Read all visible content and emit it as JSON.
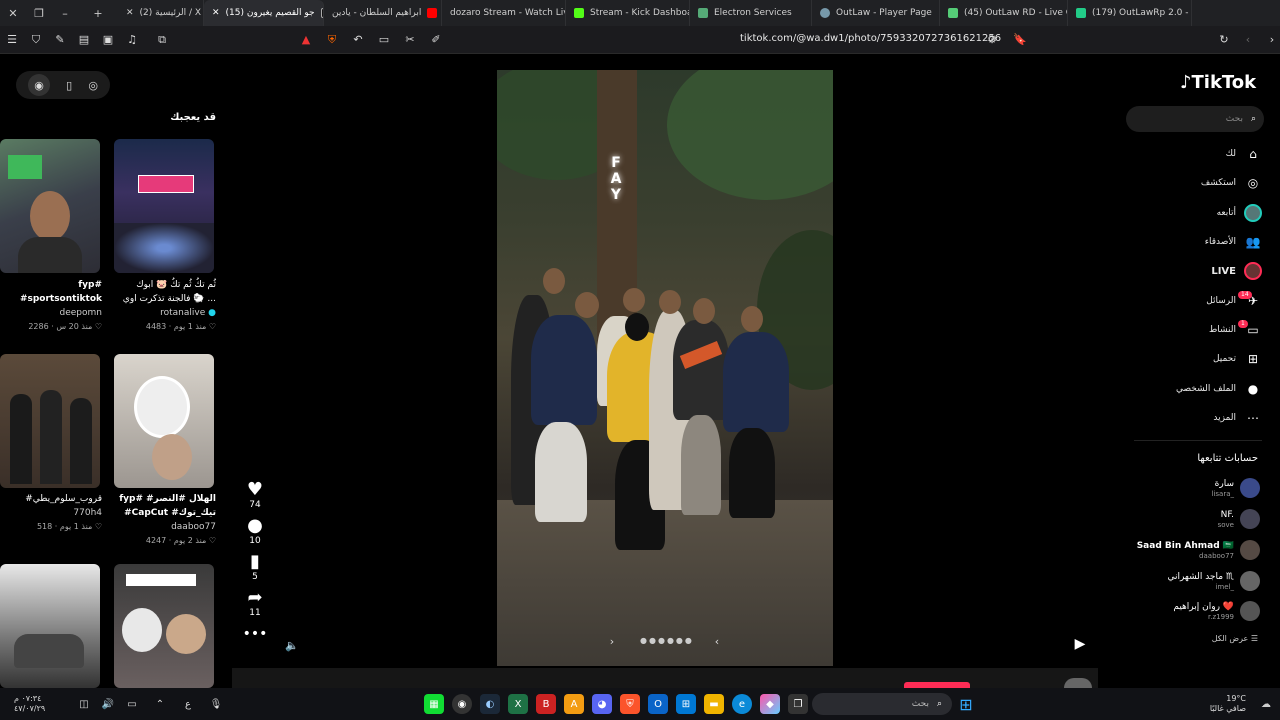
{
  "tabs": [
    {
      "title": "(2) الرئيسية / X",
      "fav": "#000"
    },
    {
      "title": "(15) جو القصيم يغيرون",
      "fav": "#111",
      "active": true
    },
    {
      "title": "ابراهيم السلطان - يادين",
      "fav": "#f00"
    },
    {
      "title": "dozaro Stream - Watch Live",
      "fav": "#53fc18"
    },
    {
      "title": "Stream - Kick Dashboard",
      "fav": "#53fc18"
    },
    {
      "title": "Electron Services",
      "fav": "#5a7"
    },
    {
      "title": "OutLaw - Player Page",
      "fav": "#79a"
    },
    {
      "title": "(45) OutLaw RD - Live Control",
      "fav": "#5c7"
    },
    {
      "title": "(179) OutLawRp 2.0 - Live",
      "fav": "#2c8"
    }
  ],
  "url": "tiktok.com/@wa.dw1/photo/7593320727361621256",
  "brand": {
    "logo": "TikTok",
    "accent": "#fe2c55"
  },
  "search_placeholder": "بحث",
  "nav": [
    {
      "label": "لك",
      "icon": "home-icon"
    },
    {
      "label": "استكشف",
      "icon": "compass-icon"
    },
    {
      "label": "أتابعه",
      "icon": "following-icon"
    },
    {
      "label": "الأصدقاء",
      "icon": "friends-icon"
    },
    {
      "label": "LIVE",
      "icon": "live-icon"
    },
    {
      "label": "الرسائل",
      "icon": "messages-icon",
      "badge": "14"
    },
    {
      "label": "النشاط",
      "icon": "activity-icon",
      "badge": "1"
    },
    {
      "label": "تحميل",
      "icon": "upload-icon"
    },
    {
      "label": "الملف الشخصي",
      "icon": "profile-icon"
    },
    {
      "label": "المزيد",
      "icon": "more-icon"
    }
  ],
  "following_title": "حسابات تتابعها",
  "following": [
    {
      "name": "سارة",
      "user": "lisara_"
    },
    {
      "name": "NF.",
      "user": "sove"
    },
    {
      "name": "Saad Bin Ahmad 🇸🇦",
      "user": "daaboo77"
    },
    {
      "name": "ماجد الشهراني ♏",
      "user": "imel_"
    },
    {
      "name": "روان إبراهيم ❤️",
      "user": "r.z1999"
    }
  ],
  "see_all": "عرض الكل",
  "reco_title": "قد يعجبك",
  "recommendations": [
    {
      "line1": "fyp#",
      "line2": "#sportsontiktok",
      "user": "deepomn",
      "likes": "2286",
      "time": "منذ 20 س"
    },
    {
      "line1": "ثُم تكُ ثُم تكُ 🐷 ابوك",
      "line2": "فالجنة تذكرت اوي 🐑 ...",
      "user": "rotanalive",
      "likes": "4483",
      "time": "منذ 1 يوم"
    },
    {
      "line1": "#قروب_سلوم_يطي",
      "line2": "",
      "user": "770h4",
      "likes": "518",
      "time": "منذ 1 يوم"
    },
    {
      "line1": "fyp# #الهلال #النصر",
      "line2": "#CapCut #تيك_توك",
      "user": "daaboo77",
      "likes": "4247",
      "time": "منذ 2 يوم"
    }
  ],
  "actions": {
    "likes": "74",
    "comments": "10",
    "saves": "5",
    "shares": "11"
  },
  "photo_text": "FAY",
  "taskbar": {
    "search": "بحث",
    "time": "٠٧:٣٤ م",
    "date": "٤٧/٠٧/٢٩",
    "weather": "19°C",
    "weather_desc": "صافي غالبًا",
    "lang": "ع"
  }
}
